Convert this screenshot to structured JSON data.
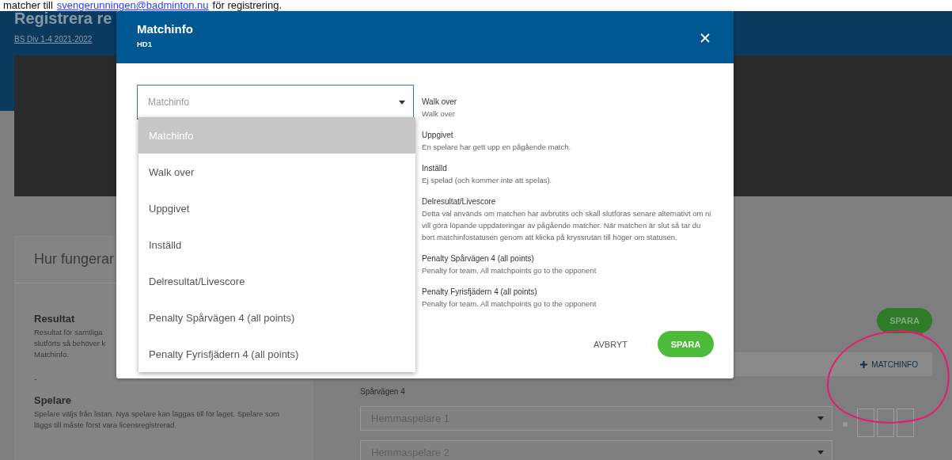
{
  "top_line": {
    "text_before": "matcher till",
    "link": "svengerunningen@badminton.nu",
    "text_after": "för registrering."
  },
  "page": {
    "title": "Registrera re",
    "breadcrumb": "BS Div 1-4 2021-2022"
  },
  "help_card": {
    "title": "Hur fungerar",
    "resultat": {
      "heading": "Resultat",
      "lines": [
        "Resultat för samtliga",
        "slutförts så behöver k",
        "Matchinfo."
      ]
    },
    "separator": "-",
    "spelare": {
      "heading": "Spelare",
      "text": "Spelare väljs från listan. Nya spelare kan läggas till för laget. Spelare som läggs till måste först vara licensregistrerad."
    }
  },
  "match_panel": {
    "save_button": "SPARA",
    "matchinfo_button": "MATCHINFO",
    "team": "Spårvägen 4",
    "player_fields": [
      {
        "placeholder": "Hemmaspelare 1"
      },
      {
        "placeholder": "Hemmaspelare 2"
      }
    ]
  },
  "modal": {
    "title": "Matchinfo",
    "subtitle": "HD1",
    "select": {
      "placeholder": "Matchinfo",
      "expanded": true,
      "options": [
        {
          "label": "Matchinfo",
          "selected": true
        },
        {
          "label": "Walk over",
          "selected": false
        },
        {
          "label": "Uppgivet",
          "selected": false
        },
        {
          "label": "Inställd",
          "selected": false
        },
        {
          "label": "Delresultat/Livescore",
          "selected": false
        },
        {
          "label": "Penalty Spårvägen 4 (all points)",
          "selected": false
        },
        {
          "label": "Penalty Fyrisfjädern 4 (all points)",
          "selected": false
        }
      ]
    },
    "descriptions": [
      {
        "title": "Walk over",
        "text": "Walk over"
      },
      {
        "title": "Uppgivet",
        "text": "En spelare har gett upp en pågående match."
      },
      {
        "title": "Inställd",
        "text": "Ej spelad (och kommer inte att spelas)."
      },
      {
        "title": "Delresultat/Livescore",
        "text": "Detta val används om matchen har avbrutits och skall slutföras senare alternativt om ni vill göra löpande uppdateringar av pågående matcher. När matchen är slut så tar du bort matchinfostatusen genom att klicka på kryssrutan till höger om statusen."
      },
      {
        "title": "Penalty Spårvägen 4 (all points)",
        "text": "Penalty for team. All matchpoints go to the opponent"
      },
      {
        "title": "Penalty Fyrisfjädern 4 (all points)",
        "text": "Penalty for team. All matchpoints go to the opponent"
      }
    ],
    "buttons": [
      {
        "label": "AVBRYT",
        "kind": "flat"
      },
      {
        "label": "SPARA",
        "kind": "primary"
      }
    ]
  }
}
